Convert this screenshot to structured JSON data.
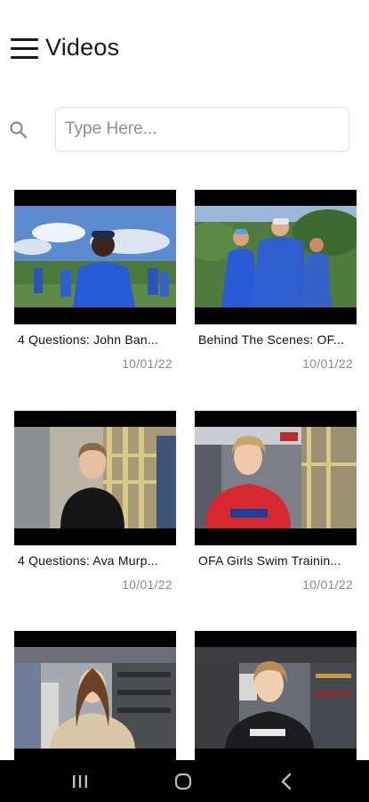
{
  "header": {
    "title": "Videos",
    "menu_icon": "hamburger-menu-icon"
  },
  "search": {
    "icon": "search-icon",
    "placeholder": "Type Here..."
  },
  "videos": [
    {
      "title": "4 Questions: John Ban...",
      "date": "10/01/22"
    },
    {
      "title": "Behind The Scenes: OF...",
      "date": "10/01/22"
    },
    {
      "title": "4 Questions: Ava Murp...",
      "date": "10/01/22"
    },
    {
      "title": "OFA Girls Swim Trainin...",
      "date": "10/01/22"
    },
    {
      "title": "",
      "date": ""
    },
    {
      "title": "",
      "date": ""
    }
  ],
  "system_nav": {
    "recents_icon": "recent-apps-icon",
    "home_icon": "home-icon",
    "back_icon": "back-icon"
  },
  "colors": {
    "background": "#ffffff",
    "text": "#111111",
    "date_text": "#8a8a8a",
    "navbar": "#000000",
    "shirt_blue": "#2a5bd7"
  }
}
